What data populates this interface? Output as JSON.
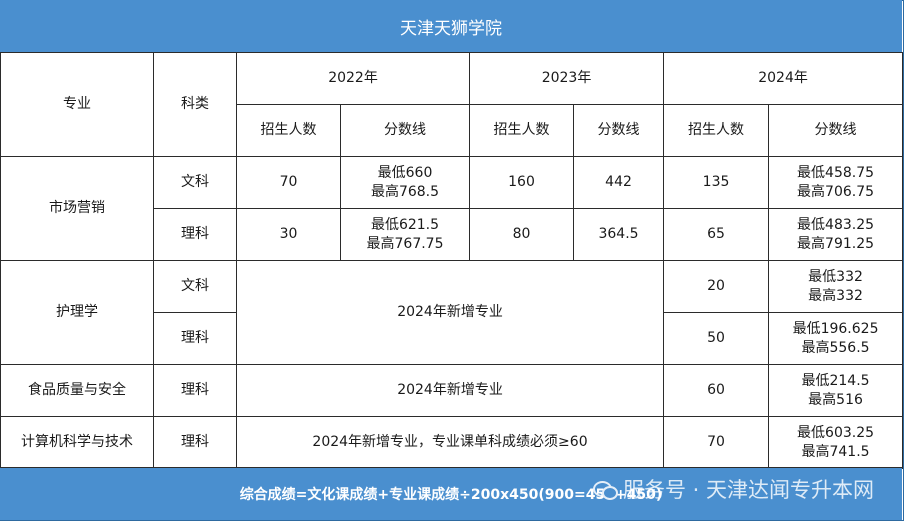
{
  "title": "天津天狮学院",
  "headers": {
    "major": "专业",
    "subject": "科类",
    "years": [
      "2022年",
      "2023年",
      "2024年"
    ],
    "enroll": "招生人数",
    "score": "分数线"
  },
  "rows": [
    {
      "major": "市场营销",
      "subject": "文科",
      "y2022": {
        "enroll": "70",
        "score_min": "最低660",
        "score_max": "最高768.5"
      },
      "y2023": {
        "enroll": "160",
        "score": "442"
      },
      "y2024": {
        "enroll": "135",
        "score_min": "最低458.75",
        "score_max": "最高706.75"
      }
    },
    {
      "subject": "理科",
      "y2022": {
        "enroll": "30",
        "score_min": "最低621.5",
        "score_max": "最高767.75"
      },
      "y2023": {
        "enroll": "80",
        "score": "364.5"
      },
      "y2024": {
        "enroll": "65",
        "score_min": "最低483.25",
        "score_max": "最高791.25"
      }
    },
    {
      "major": "护理学",
      "subject": "文科",
      "note": "2024年新增专业",
      "y2024": {
        "enroll": "20",
        "score_min": "最低332",
        "score_max": "最高332"
      }
    },
    {
      "subject": "理科",
      "y2024": {
        "enroll": "50",
        "score_min": "最低196.625",
        "score_max": "最高556.5"
      }
    },
    {
      "major": "食品质量与安全",
      "subject": "理科",
      "note": "2024年新增专业",
      "y2024": {
        "enroll": "60",
        "score_min": "最低214.5",
        "score_max": "最高516"
      }
    },
    {
      "major": "计算机科学与技术",
      "subject": "理科",
      "note": "2024年新增专业，专业课单科成绩必须≥60",
      "y2024": {
        "enroll": "70",
        "score_min": "最低603.25",
        "score_max": "最高741.5"
      }
    }
  ],
  "footer": {
    "formula": "综合成绩=文化课成绩+专业课成绩÷200x450(900=450+450)",
    "watermark": "服务号 · 天津达闻专升本网",
    "watermark_icon": "wechat-icon"
  },
  "colors": {
    "bar": "#4a8fcf",
    "border": "#2b2b2b"
  }
}
